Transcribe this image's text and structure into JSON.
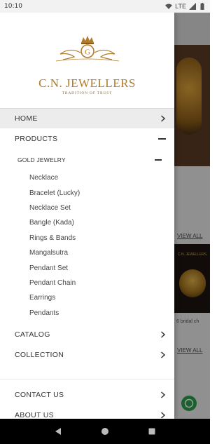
{
  "status": {
    "time": "10:10",
    "network": "LTE"
  },
  "brand": {
    "monogram": "G",
    "name": "C.N. JEWELLERS",
    "tagline": "TRADITION OF TRUST"
  },
  "menu": {
    "home": "HOME",
    "products": "PRODUCTS",
    "gold_jewelry": "GOLD JEWELRY",
    "gold_items": [
      "Necklace",
      "Bracelet (Lucky)",
      "Necklace Set",
      "Bangle (Kada)",
      "Rings & Bands",
      "Mangalsutra",
      "Pendant Set",
      "Pendant Chain",
      "Earrings",
      "Pendants"
    ],
    "catalog": "CATALOG",
    "collection": "COLLECTION",
    "contact_us": "CONTACT US",
    "about_us": "ABOUT US"
  },
  "background": {
    "view_all_1": "VIEW ALL",
    "view_all_2": "VIEW ALL",
    "card_logo": "C.N. JEWELLERS",
    "card_caption": "6 bridal ch"
  },
  "icons": {
    "wifi": "wifi-icon",
    "signal": "signal-icon",
    "battery": "battery-icon",
    "chevron": "chevron-right-icon",
    "collapse": "minus-icon",
    "whatsapp": "whatsapp-icon",
    "back": "nav-back-icon",
    "home": "nav-home-icon",
    "recents": "nav-recents-icon"
  },
  "colors": {
    "gold": "#b07c2c",
    "active_bg": "#ececec",
    "whatsapp": "#2a9d4a"
  }
}
